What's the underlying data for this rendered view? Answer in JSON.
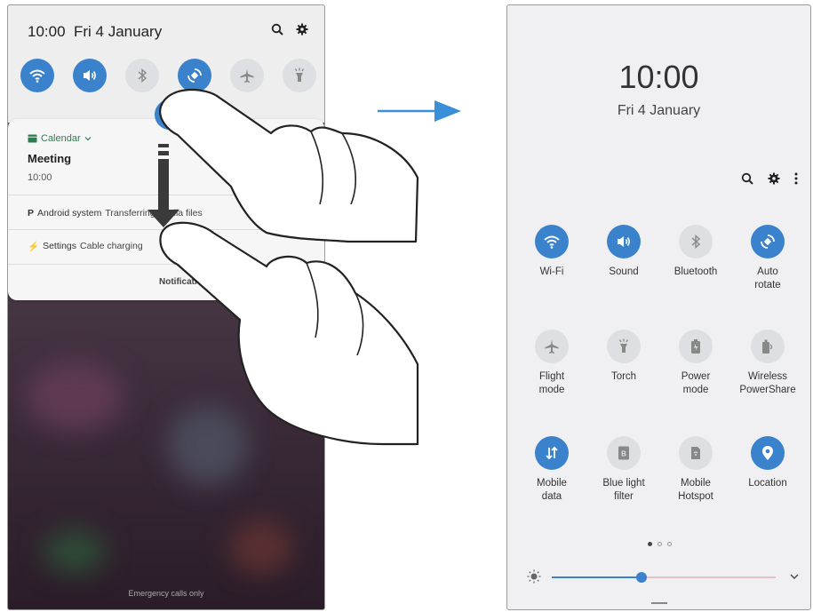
{
  "left": {
    "time": "10:00",
    "date": "Fri 4 January",
    "quick_toggles": [
      {
        "name": "wifi",
        "icon": "wifi-icon",
        "state": "on"
      },
      {
        "name": "sound",
        "icon": "volume-icon",
        "state": "on"
      },
      {
        "name": "bluetooth",
        "icon": "bluetooth-icon",
        "state": "off"
      },
      {
        "name": "auto-rotate",
        "icon": "rotate-icon",
        "state": "on"
      },
      {
        "name": "flight-mode",
        "icon": "airplane-icon",
        "state": "off"
      },
      {
        "name": "torch",
        "icon": "flashlight-icon",
        "state": "off"
      }
    ],
    "notification": {
      "app": "Calendar",
      "title": "Meeting",
      "time": "10:00"
    },
    "android_row": {
      "app": "Android system",
      "text": "Transferring media files"
    },
    "settings_row": {
      "app": "Settings",
      "text": "Cable charging"
    },
    "notif_settings": "Notification settings",
    "emergency": "Emergency calls only"
  },
  "right": {
    "time": "10:00",
    "date": "Fri 4 January",
    "tiles": [
      {
        "label_1": "Wi-Fi",
        "label_2": "",
        "icon": "wifi-icon",
        "state": "on"
      },
      {
        "label_1": "Sound",
        "label_2": "",
        "icon": "volume-icon",
        "state": "on"
      },
      {
        "label_1": "Bluetooth",
        "label_2": "",
        "icon": "bluetooth-icon",
        "state": "off"
      },
      {
        "label_1": "Auto",
        "label_2": "rotate",
        "icon": "rotate-icon",
        "state": "on"
      },
      {
        "label_1": "Flight",
        "label_2": "mode",
        "icon": "airplane-icon",
        "state": "off"
      },
      {
        "label_1": "Torch",
        "label_2": "",
        "icon": "flashlight-icon",
        "state": "off"
      },
      {
        "label_1": "Power",
        "label_2": "mode",
        "icon": "battery-icon",
        "state": "off"
      },
      {
        "label_1": "Wireless",
        "label_2": "PowerShare",
        "icon": "wireless-powershare-icon",
        "state": "off"
      },
      {
        "label_1": "Mobile",
        "label_2": "data",
        "icon": "mobile-data-icon",
        "state": "on"
      },
      {
        "label_1": "Blue light",
        "label_2": "filter",
        "icon": "blue-light-filter-icon",
        "state": "off"
      },
      {
        "label_1": "Mobile",
        "label_2": "Hotspot",
        "icon": "hotspot-icon",
        "state": "off"
      },
      {
        "label_1": "Location",
        "label_2": "",
        "icon": "location-icon",
        "state": "on"
      }
    ],
    "page_index": 1,
    "page_count": 3,
    "brightness": 0.4
  },
  "colors": {
    "accent": "#3a82cc",
    "tile_off": "#dedfe2",
    "calendar_green": "#2e7d4f"
  }
}
